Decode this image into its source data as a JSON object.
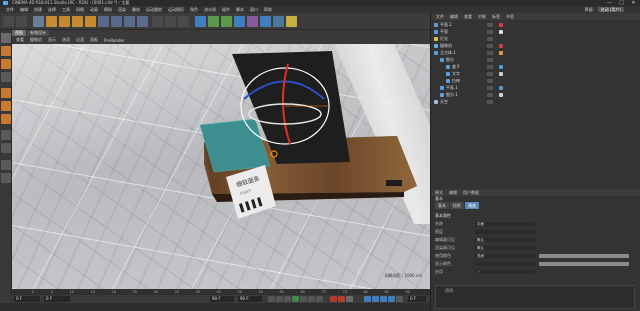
{
  "app": {
    "title": "CINEMA 4D R18.011 Studio (RC - R18) - [0001.c4d *] - 主要",
    "window_buttons": [
      "—",
      "□",
      "✕"
    ]
  },
  "menubar": {
    "items": [
      "文件",
      "编辑",
      "创建",
      "选择",
      "工具",
      "网格",
      "动画",
      "模拟",
      "渲染",
      "雕刻",
      "运动跟踪",
      "运动图形",
      "角色",
      "流水线",
      "插件",
      "脚本",
      "窗口",
      "帮助"
    ],
    "interface_label": "界面:",
    "layout_value": "启动 (用户)"
  },
  "viewport": {
    "tabs": [
      "视图",
      "有效设计"
    ],
    "active_tab": "视图",
    "menu": [
      "查看",
      "摄像机",
      "显示",
      "选项",
      "过滤",
      "面板",
      "ProRender"
    ],
    "scale_label": "网格间距 : 1000 cm",
    "box_text": [
      "细软面条",
      "小山小"
    ],
    "accent_color": "#ff8a00"
  },
  "timeline": {
    "ticks": [
      "0",
      "5",
      "10",
      "15",
      "20",
      "25",
      "30",
      "35",
      "40",
      "45",
      "50",
      "55",
      "60",
      "65",
      "70",
      "75",
      "80",
      "85",
      "90"
    ],
    "current_frame": "0 F",
    "start_field": "0 F",
    "end_field": "90 F",
    "end_field2": "90 F",
    "frame_display": "0 F"
  },
  "objects": {
    "menu": [
      "文件",
      "编辑",
      "查看",
      "对象",
      "标签",
      "书签"
    ],
    "items": [
      {
        "name": "平面.2",
        "icon_color": "#5aa0e0",
        "tag_color": "#d04040"
      },
      {
        "name": "平面",
        "icon_color": "#5aa0e0",
        "tag_color": "#e0e0e0"
      },
      {
        "name": "灯光",
        "icon_color": "#e0c040",
        "tag_color": ""
      },
      {
        "name": "摄像机",
        "icon_color": "#60b0e0",
        "tag_color": "#d04040"
      },
      {
        "name": "立方体.1",
        "icon_color": "#5aa0e0",
        "tag_color": "#e0a040"
      },
      {
        "name": "细分",
        "icon_color": "#5aa0e0",
        "tag_color": ""
      },
      {
        "name": "盒子",
        "icon_color": "#5aa0e0",
        "tag_color": "#40a0d0"
      },
      {
        "name": "文字",
        "icon_color": "#5aa0e0",
        "tag_color": "#d0d0d0"
      },
      {
        "name": "拉伸",
        "icon_color": "#5aa0e0",
        "tag_color": ""
      },
      {
        "name": "平面.1",
        "icon_color": "#5aa0e0",
        "tag_color": "#40a0d0"
      },
      {
        "name": "细分.1",
        "icon_color": "#5aa0e0",
        "tag_color": "#d0d0d0"
      },
      {
        "name": "天空",
        "icon_color": "#9cc0e8",
        "tag_color": ""
      }
    ]
  },
  "attributes": {
    "menu": [
      "模式",
      "编辑",
      "用户数据"
    ],
    "header": "基本",
    "subtabs": [
      "基本",
      "投影",
      "通道"
    ],
    "active_subtab": "通道",
    "section_title": "基本属性",
    "rows": [
      {
        "label": "名称",
        "value": "平面"
      },
      {
        "label": "图层",
        "value": ""
      },
      {
        "label": "编辑器可见",
        "value": "默认"
      },
      {
        "label": "渲染器可见",
        "value": "默认"
      },
      {
        "label": "使用颜色",
        "value": "关闭"
      },
      {
        "label": "显示颜色",
        "value": ""
      },
      {
        "label": "启用",
        "value": "✓"
      }
    ],
    "graph_label": "透明"
  }
}
